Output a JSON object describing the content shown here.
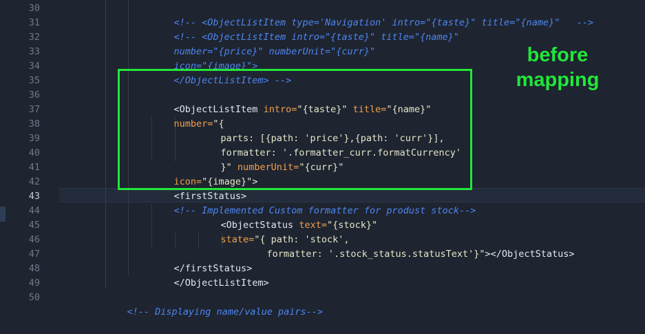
{
  "editor": {
    "line_numbers": [
      "30",
      "31",
      "32",
      "33",
      "34",
      "35",
      "36",
      "37",
      "38",
      "39",
      "40",
      "41",
      "42",
      "43",
      "44",
      "45",
      "46",
      "47",
      "48",
      "49",
      "50"
    ],
    "active_line": "43",
    "lines": {
      "l30": {
        "p1": "<!-- <ObjectListItem type='Navigation' intro=\"{taste}\" title=\"{name}\"   -->"
      },
      "l31": {
        "p1": "<!-- <ObjectListItem intro=\"{taste}\" title=\"{name}\""
      },
      "l32": {
        "p1": "number=\"{price}\" numberUnit=\"{curr}\""
      },
      "l33": {
        "p1": "icon=\"{image}\">"
      },
      "l34": {
        "p1": "</ObjectListItem> -->"
      },
      "l36": {
        "p1": "<ObjectListItem ",
        "p2": "intro=",
        "p3": "\"{taste}\"",
        "p4": " title=",
        "p5": "\"{name}\""
      },
      "l37": {
        "p1": "number=",
        "p2": "\"{"
      },
      "l38": {
        "p1": "parts: [{path: 'price'},{path: 'curr'}],"
      },
      "l39": {
        "p1": "formatter: '.formatter_curr.formatCurrency'"
      },
      "l40": {
        "p1": "}\"",
        "p2": " numberUnit=",
        "p3": "\"{curr}\""
      },
      "l41": {
        "p1": "icon=",
        "p2": "\"{image}\"",
        "p3": ">"
      },
      "l42": {
        "p1": "<firstStatus>"
      },
      "l43": {
        "p1": "<!-- Implemented Custom formatter for produst stock-->"
      },
      "l44": {
        "p1": "<ObjectStatus ",
        "p2": "text=",
        "p3": "\"{stock}\""
      },
      "l45": {
        "p1": "state=",
        "p2": "\"{ path: 'stock',"
      },
      "l46": {
        "p1": "formatter: '.stock_status.statusText'}\"",
        "p2": "></ObjectStatus>"
      },
      "l47": {
        "p1": "</firstStatus>"
      },
      "l48": {
        "p1": "</ObjectListItem>"
      },
      "l50": {
        "p1": "<!-- Displaying name/value pairs-->"
      }
    }
  },
  "annotation": {
    "line1": "before",
    "line2": "mapping",
    "color": "#22e63a"
  },
  "colors": {
    "background": "#1e2430",
    "comment": "#4e86f0",
    "tag": "#e3e7ee",
    "attribute": "#f2a24c",
    "string": "#e4e6c8",
    "line_number": "#6d7a8a"
  }
}
